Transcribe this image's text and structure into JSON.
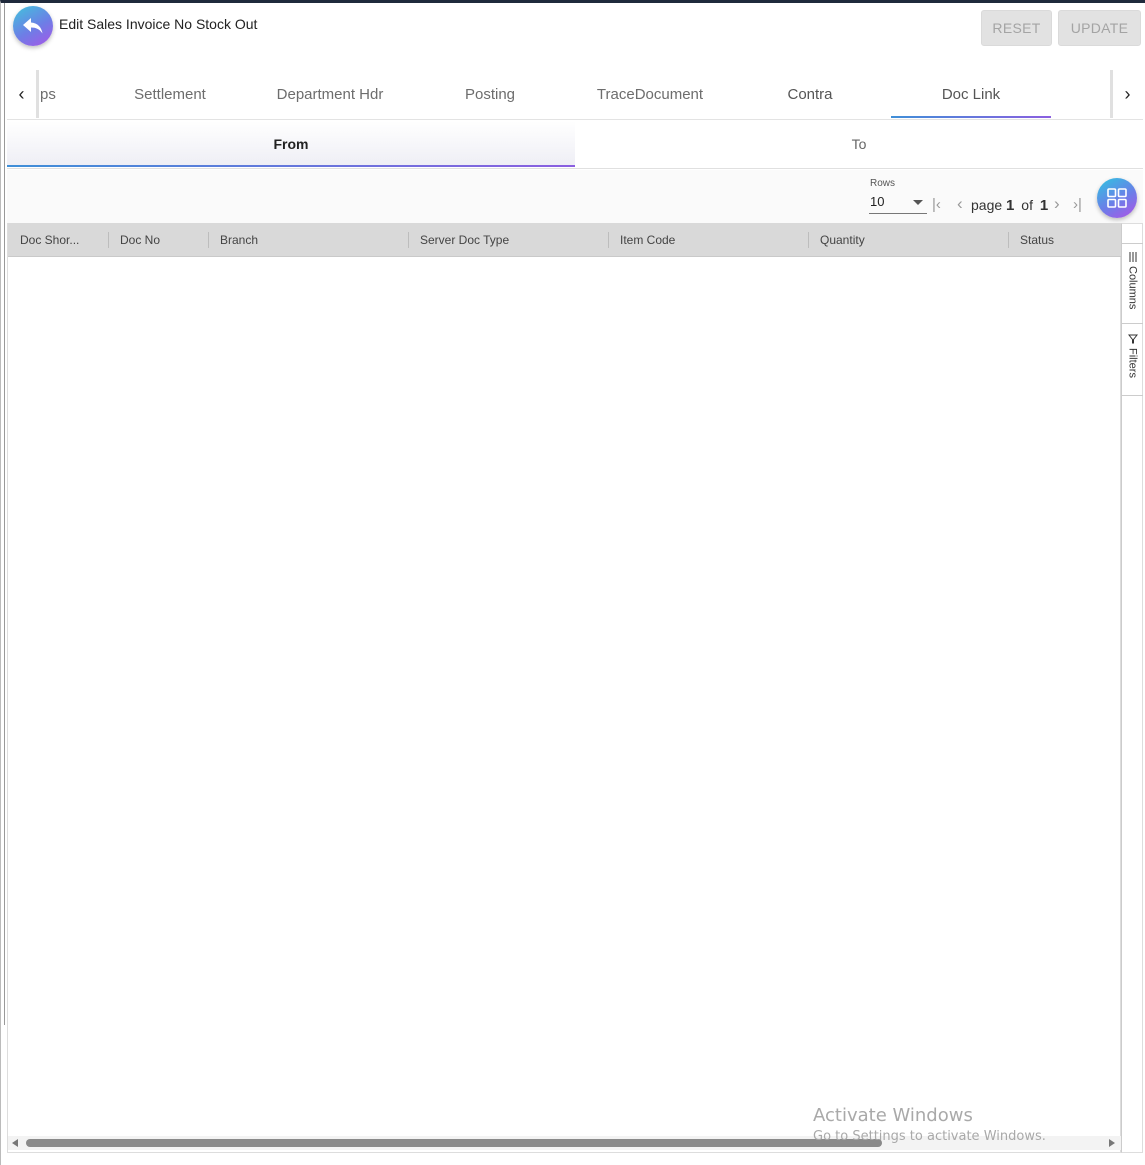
{
  "header": {
    "title": "Edit Sales Invoice No Stock Out",
    "reset_label": "RESET",
    "update_label": "UPDATE"
  },
  "tabs": [
    {
      "label": "ps"
    },
    {
      "label": "Settlement"
    },
    {
      "label": "Department Hdr"
    },
    {
      "label": "Posting"
    },
    {
      "label": "TraceDocument"
    },
    {
      "label": "Contra"
    },
    {
      "label": "Doc Link"
    }
  ],
  "active_tab": "Doc Link",
  "subtabs": {
    "from": "From",
    "to": "To"
  },
  "pager": {
    "rows_label": "Rows",
    "rows_value": "10",
    "page_word": "page",
    "current_page": "1",
    "of_word": "of",
    "total_pages": "1"
  },
  "grid": {
    "columns": [
      "Doc Shor...",
      "Doc No",
      "Branch",
      "Server Doc Type",
      "Item Code",
      "Quantity",
      "Status"
    ],
    "rows": []
  },
  "side_panel": {
    "columns_label": "Columns",
    "filters_label": "Filters"
  },
  "watermark": {
    "line1": "Activate Windows",
    "line2": "Go to Settings to activate Windows."
  },
  "colors": {
    "accent_start": "#3f8fd8",
    "accent_end": "#8b5fe0",
    "header_bg": "#d9d9d9"
  }
}
